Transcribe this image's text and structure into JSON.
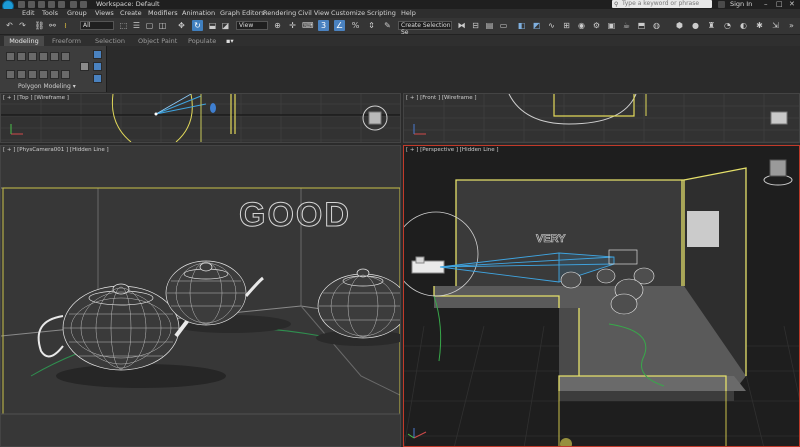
{
  "titlebar": {
    "workspace": "Workspace: Default",
    "search_placeholder": "Type a keyword or phrase",
    "sign_in": "Sign In"
  },
  "menu": [
    "Edit",
    "Tools",
    "Group",
    "Views",
    "Create",
    "Modifiers",
    "Animation",
    "Graph Editors",
    "Rendering",
    "Civil View",
    "Customize",
    "Scripting",
    "Help"
  ],
  "toolbar": {
    "selection_filter": "All",
    "reference_coord": "View",
    "named_selection": "Create Selection Se"
  },
  "ribbon": {
    "tabs": [
      "Modeling",
      "Freeform",
      "Selection",
      "Object Paint",
      "Populate"
    ],
    "panel_label": "Polygon Modeling"
  },
  "viewports": {
    "top": "[ + ] [Top ] [Wireframe ]",
    "front": "[ + ] [Front ] [Wireframe ]",
    "camera": "[ + ] [PhysCamera001 ] [Hidden Line ]",
    "perspective": "[ + ] [Perspective ] [Hidden Line ]"
  },
  "scene_text": {
    "good": "GOOD",
    "very": "VERY"
  },
  "colors": {
    "accent": "#1c9bd6",
    "selection": "#e5e06a",
    "active_viewport": "#c23a2a"
  }
}
